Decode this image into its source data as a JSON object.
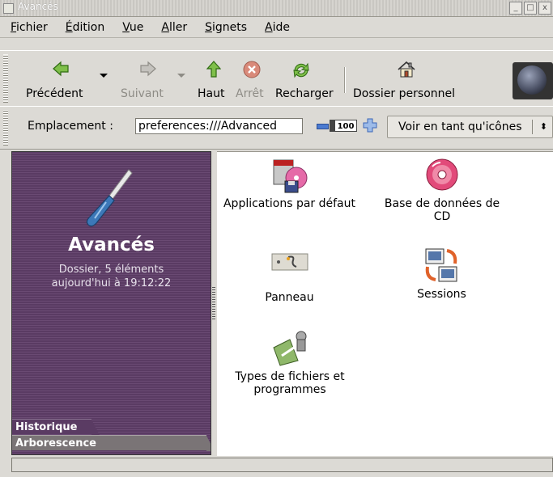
{
  "window": {
    "title": "Avancés",
    "min": "_",
    "max": "□",
    "close": "x"
  },
  "menu": [
    "Fichier",
    "Édition",
    "Vue",
    "Aller",
    "Signets",
    "Aide"
  ],
  "toolbar": {
    "back": "Précédent",
    "forward": "Suivant",
    "up": "Haut",
    "stop": "Arrêt",
    "reload": "Recharger",
    "home": "Dossier personnel"
  },
  "location": {
    "label": "Emplacement :",
    "value": "preferences:///Advanced",
    "zoom": "100",
    "view_as": "Voir en tant qu'icônes",
    "view_arrow": "⬍"
  },
  "sidebar": {
    "title": "Avancés",
    "line1": "Dossier, 5 éléments",
    "line2": "aujourd'hui à 19:12:22",
    "tab_history": "Historique",
    "tab_tree": "Arborescence"
  },
  "items": [
    {
      "label": "Applications par défaut",
      "icon": "default-applications-icon"
    },
    {
      "label": "Base de données de CD",
      "icon": "cd-database-icon"
    },
    {
      "label": "Panneau",
      "icon": "panel-icon"
    },
    {
      "label": "Sessions",
      "icon": "sessions-icon"
    },
    {
      "label": "Types de fichiers et programmes",
      "icon": "file-types-icon"
    }
  ],
  "colors": {
    "sidebar_bg": "#5a3b63",
    "arrow_green": "#3f8c1e",
    "window_bg": "#dcdad5"
  }
}
